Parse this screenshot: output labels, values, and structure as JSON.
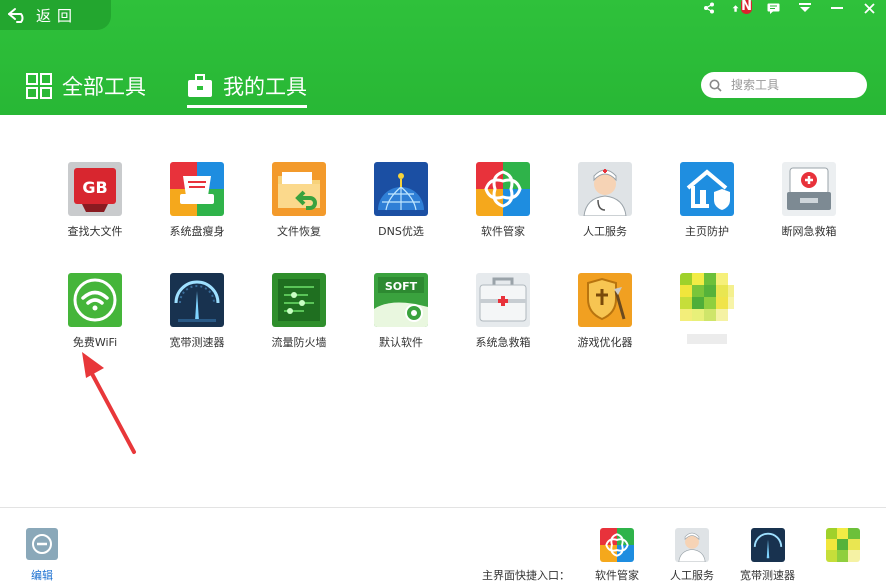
{
  "header": {
    "back_label": "返回",
    "tabs": [
      {
        "label": "全部工具",
        "icon": "grid-icon"
      },
      {
        "label": "我的工具",
        "icon": "toolbox-icon",
        "active": true
      }
    ],
    "search_placeholder": "搜索工具",
    "notification_badge": "N"
  },
  "tools": [
    {
      "label": "查找大文件",
      "icon": "gb-file-icon"
    },
    {
      "label": "系统盘瘦身",
      "icon": "disk-slim-icon"
    },
    {
      "label": "文件恢复",
      "icon": "folder-restore-icon"
    },
    {
      "label": "DNS优选",
      "icon": "dns-globe-icon"
    },
    {
      "label": "软件管家",
      "icon": "software-manager-icon"
    },
    {
      "label": "人工服务",
      "icon": "doctor-icon"
    },
    {
      "label": "主页防护",
      "icon": "home-shield-icon"
    },
    {
      "label": "断网急救箱",
      "icon": "network-firstaid-icon"
    },
    {
      "label": "免费WiFi",
      "icon": "wifi-icon"
    },
    {
      "label": "宽带测速器",
      "icon": "speedometer-icon"
    },
    {
      "label": "流量防火墙",
      "icon": "traffic-firewall-icon"
    },
    {
      "label": "默认软件",
      "icon": "soft-default-icon"
    },
    {
      "label": "系统急救箱",
      "icon": "system-firstaid-icon"
    },
    {
      "label": "游戏优化器",
      "icon": "game-optimizer-icon"
    },
    {
      "label": "",
      "icon": "blurred-tool-icon"
    }
  ],
  "footer": {
    "edit_label": "编辑",
    "quick_entry_label": "主界面快捷入口：",
    "quick_items": [
      {
        "label": "软件管家",
        "icon": "software-manager-icon"
      },
      {
        "label": "人工服务",
        "icon": "doctor-icon"
      },
      {
        "label": "宽带测速器",
        "icon": "speedometer-icon"
      },
      {
        "label": "",
        "icon": "blurred-tool-icon"
      }
    ]
  },
  "colors": {
    "header_green": "#2fc13b",
    "arrow_red": "#e8373a"
  }
}
